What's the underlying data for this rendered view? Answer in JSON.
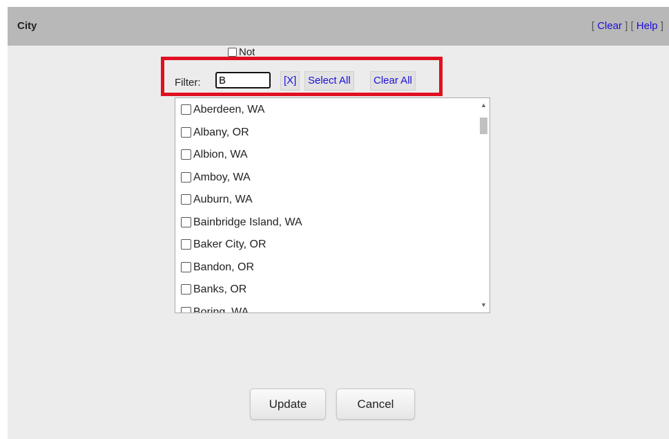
{
  "header": {
    "title": "City",
    "clear_label": "Clear",
    "help_label": "Help"
  },
  "not_label": "Not",
  "filter": {
    "label": "Filter:",
    "value": "B",
    "clear_x_label": "[X]",
    "select_all_label": "Select All",
    "clear_all_label": "Clear All"
  },
  "cities": [
    "Aberdeen, WA",
    "Albany, OR",
    "Albion, WA",
    "Amboy, WA",
    "Auburn, WA",
    "Bainbridge Island, WA",
    "Baker City, OR",
    "Bandon, OR",
    "Banks, OR",
    "Boring, WA"
  ],
  "buttons": {
    "update_label": "Update",
    "cancel_label": "Cancel"
  },
  "colors": {
    "highlight": "#e01020",
    "link": "#1a0dd8"
  }
}
